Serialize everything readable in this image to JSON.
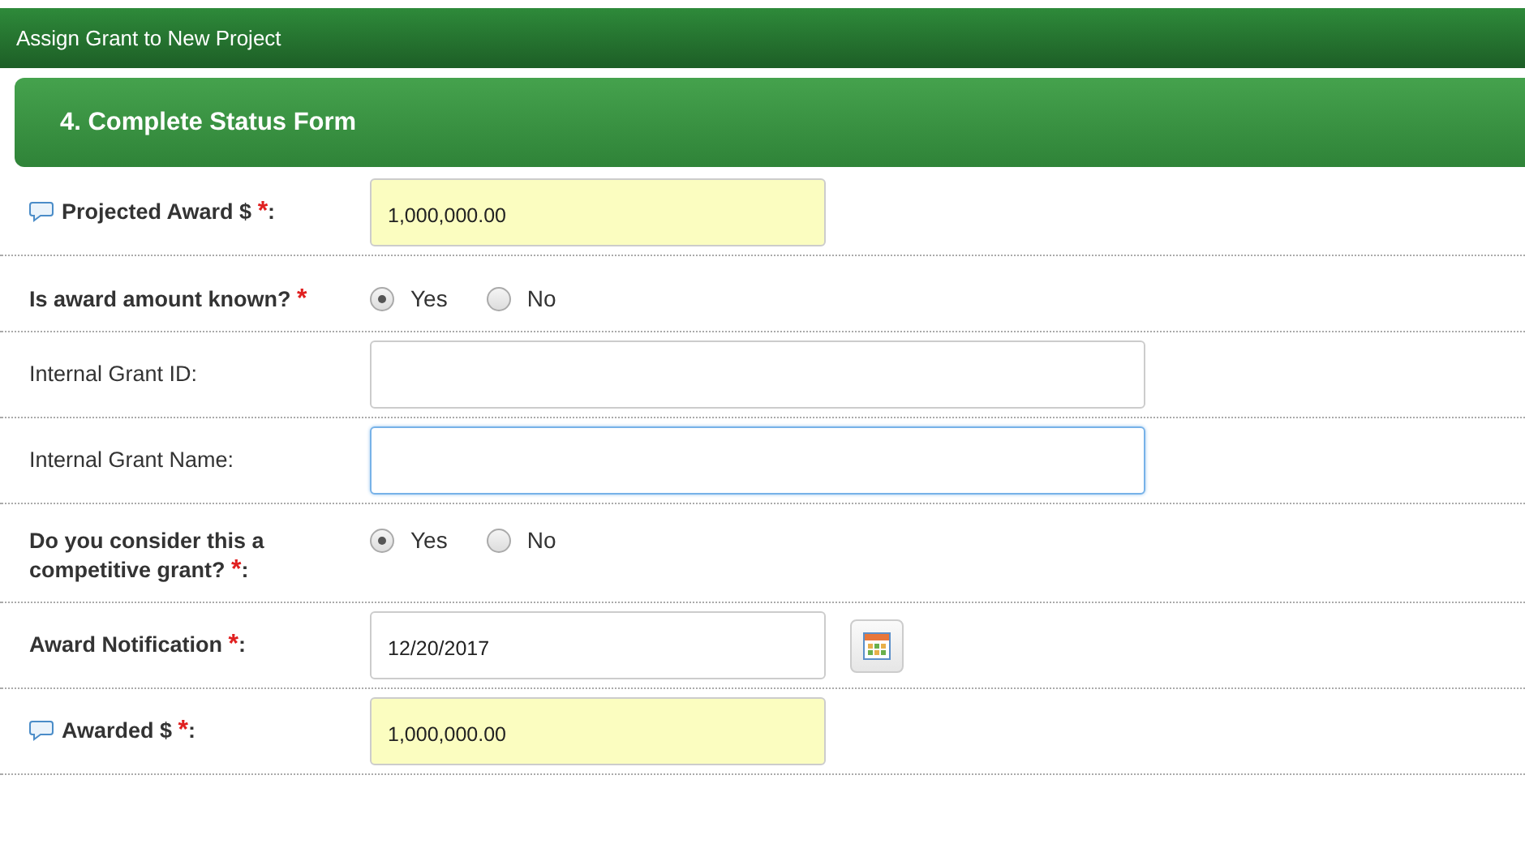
{
  "window": {
    "title": "Assign Grant to New Project"
  },
  "section": {
    "title": "4. Complete Status Form"
  },
  "fields": [
    {
      "kind": "text",
      "label": "Projected Award $",
      "bold": true,
      "marker": "*",
      "colon": ":",
      "comment_icon": true,
      "value": "1,000,000.00",
      "highlighted": true,
      "focused": false,
      "wide": false
    },
    {
      "kind": "radio",
      "label": "Is award amount known?",
      "bold": true,
      "marker": "*",
      "comment_icon": false,
      "options": [
        {
          "label": "Yes",
          "selected": true
        },
        {
          "label": "No",
          "selected": false
        }
      ]
    },
    {
      "kind": "text",
      "label": "Internal Grant ID:",
      "bold": false,
      "comment_icon": false,
      "highlighted": false,
      "focused": false,
      "wide": true
    },
    {
      "kind": "text",
      "label": "Internal Grant Name:",
      "bold": false,
      "comment_icon": false,
      "highlighted": false,
      "focused": true,
      "wide": true
    },
    {
      "kind": "radio",
      "label": "Do you consider this a competitive grant?",
      "bold": true,
      "marker": "*",
      "colon": ":",
      "comment_icon": false,
      "options": [
        {
          "label": "Yes",
          "selected": true
        },
        {
          "label": "No",
          "selected": false
        }
      ]
    },
    {
      "kind": "date",
      "label": "Award Notification",
      "bold": true,
      "marker": "*",
      "colon": ":",
      "comment_icon": false,
      "value": "12/20/2017",
      "highlighted": false,
      "focused": false,
      "wide": false
    },
    {
      "kind": "text",
      "label": "Awarded $",
      "bold": true,
      "marker": "*",
      "colon": ":",
      "comment_icon": true,
      "value": "1,000,000.00",
      "highlighted": true,
      "focused": false,
      "wide": false
    }
  ]
}
